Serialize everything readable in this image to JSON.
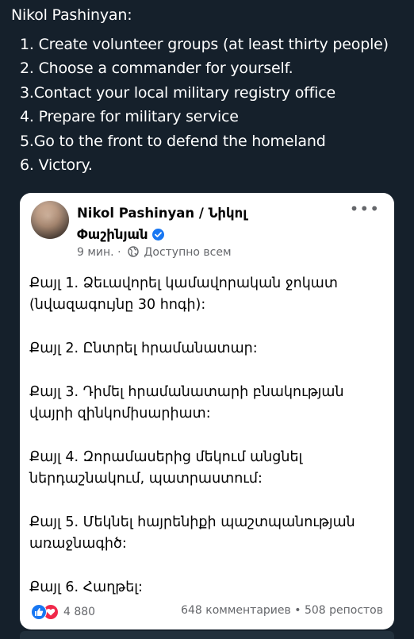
{
  "tweet": {
    "lines": [
      "Nikol Pashinyan:",
      "1. Create volunteer groups (at least thirty people)",
      "2. Choose a commander for yourself.",
      "3.Contact your local military registry office",
      "4. Prepare for military service",
      "5.Go to the front to defend the homeland",
      "6. Victory."
    ]
  },
  "post": {
    "author_line1": "Nikol Pashinyan / Նիկոլ",
    "author_line2": "Փաշինյան",
    "time": "9 мин.",
    "separator": "·",
    "audience": "Доступно всем",
    "more_label": "•••",
    "paragraphs": [
      "Քայլ 1. Ձեւավորել կամավորական ջոկատ (նվազագույնը 30 հոգի):",
      "Քայլ 2. Ընտրել հրամանատար:",
      "Քայլ 3. Դիմել հրամանատարի բնակության վայրի զինկոմիսարիատ:",
      "Քայլ 4. Զորամասերից մեկում անցնել ներդաշնակում, պատրաստում:",
      "Քայլ 5. Մեկնել հայրենիքի պաշտպանության առաջնագիծ:",
      "Քայլ 6. Հաղթել:"
    ],
    "reaction_count": "4 880",
    "comments": "648 комментариев",
    "stats_separator": "•",
    "shares": "508 репостов",
    "icons": [
      "like-icon",
      "love-icon",
      "verified-icon",
      "globe-icon",
      "more-icon"
    ],
    "colors": {
      "facebook_blue": "#1877f2",
      "love_red": "#f0284a",
      "muted_text": "#65676b",
      "background": "#15202b"
    }
  }
}
